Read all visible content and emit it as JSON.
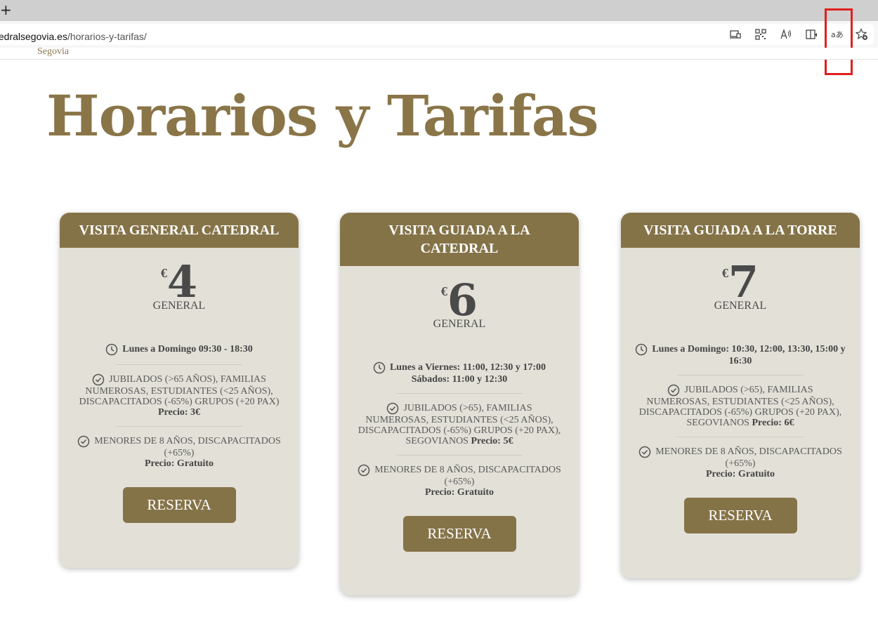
{
  "browser": {
    "new_tab": "+",
    "url_host": "tedralsegovia.es",
    "url_path": "/horarios-y-tarifas/",
    "highlight_color": "#e0201f"
  },
  "header": {
    "logo_text": "Segovia"
  },
  "page": {
    "title": "Horarios y Tarifas"
  },
  "colors": {
    "brand": "#857348",
    "card_bg": "#e2e0d7",
    "title": "#8a7548"
  },
  "cards": [
    {
      "title": "VISITA GENERAL CATEDRAL",
      "currency": "€",
      "price": "4",
      "price_label": "GENERAL",
      "schedule": "Lunes a Domingo 09:30 - 18:30",
      "reduced": "JUBILADOS (>65 AÑOS), FAMILIAS NUMEROSAS, ESTUDIANTES (<25 AÑOS), DISCAPACITADOS (-65%) GRUPOS (+20 PAX)",
      "reduced_price": "Precio: 3€",
      "free": "MENORES DE 8 AÑOS, DISCAPACITADOS (+65%)",
      "free_price": "Precio: Gratuito",
      "button": "RESERVA"
    },
    {
      "title": "VISITA GUIADA A LA CATEDRAL",
      "currency": "€",
      "price": "6",
      "price_label": "GENERAL",
      "schedule": "Lunes a Viernes: 11:00, 12:30 y 17:00 Sábados: 11:00 y 12:30",
      "reduced": "JUBILADOS (>65), FAMILIAS NUMEROSAS, ESTUDIANTES (<25 AÑOS), DISCAPACITADOS (-65%) GRUPOS (+20 PAX), SEGOVIANOS",
      "reduced_price": "Precio: 5€",
      "free": "MENORES DE 8 AÑOS, DISCAPACITADOS (+65%)",
      "free_price": "Precio: Gratuito",
      "button": "RESERVA"
    },
    {
      "title": "VISITA GUIADA A LA TORRE",
      "currency": "€",
      "price": "7",
      "price_label": "GENERAL",
      "schedule": "Lunes a Domingo: 10:30, 12:00, 13:30, 15:00 y 16:30",
      "reduced": "JUBILADOS (>65), FAMILIAS NUMEROSAS, ESTUDIANTES (<25 AÑOS), DISCAPACITADOS (-65%) GRUPOS (+20 PAX), SEGOVIANOS",
      "reduced_price": "Precio: 6€",
      "free": "MENORES DE 8 AÑOS, DISCAPACITADOS (+65%)",
      "free_price": "Precio: Gratuito",
      "button": "RESERVA"
    }
  ]
}
